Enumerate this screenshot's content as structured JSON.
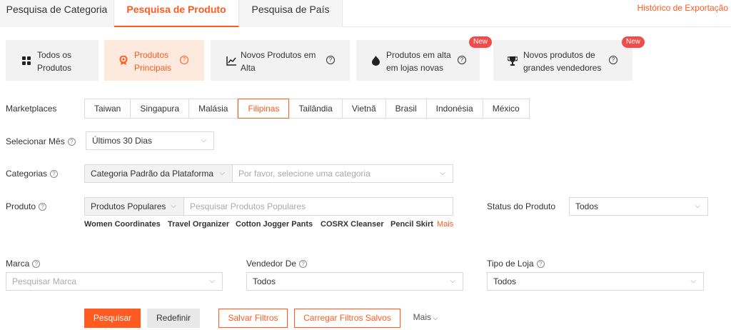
{
  "tabs": [
    {
      "label": "Pesquisa de Categoria",
      "active": false
    },
    {
      "label": "Pesquisa de Produto",
      "active": true
    },
    {
      "label": "Pesquisa de País",
      "active": false
    }
  ],
  "export_link": "Histórico de Exportação",
  "cards": [
    {
      "label": "Todos os Produtos",
      "icon": "grid-icon",
      "active": false,
      "help": false,
      "badge": ""
    },
    {
      "label": "Produtos Principais",
      "icon": "medal-icon",
      "active": true,
      "help": true,
      "badge": ""
    },
    {
      "label": "Novos Produtos em Alta",
      "icon": "trend-chart-icon",
      "active": false,
      "help": true,
      "badge": ""
    },
    {
      "label": "Produtos em alta em lojas novas",
      "icon": "flame-icon",
      "active": false,
      "help": true,
      "badge": "New"
    },
    {
      "label": "Novos produtos de grandes vendedores",
      "icon": "trophy-icon",
      "active": false,
      "help": true,
      "badge": "New"
    }
  ],
  "filters": {
    "marketplaces_label": "Marketplaces",
    "marketplaces": [
      "Taiwan",
      "Singapura",
      "Malásia",
      "Filipinas",
      "Tailândia",
      "Vietnã",
      "Brasil",
      "Indonésia",
      "México"
    ],
    "marketplace_selected": "Filipinas",
    "month_label": "Selecionar Mês",
    "month_value": "Últimos 30 Dias",
    "categories_label": "Categorias",
    "category_source": "Categoria Padrão da Plataforma",
    "category_placeholder": "Por favor, selecione uma categoria",
    "product_label": "Produto",
    "product_type": "Produtos Populares",
    "product_placeholder": "Pesquisar Produtos Populares",
    "product_status_label": "Status do Produto",
    "product_status_value": "Todos",
    "popular_keywords": [
      "Women Coordinates",
      "Travel Organizer",
      "Cotton Jogger Pants",
      "COSRX Cleanser",
      "Pencil Skirt"
    ],
    "more_keywords": "Mais",
    "brand_label": "Marca",
    "brand_placeholder": "Pesquisar Marca",
    "seller_label": "Vendedor De",
    "seller_value": "Todos",
    "store_type_label": "Tipo de Loja",
    "store_type_value": "Todos"
  },
  "actions": {
    "search": "Pesquisar",
    "reset": "Redefinir",
    "save_filters": "Salvar Filtros",
    "load_filters": "Carregar Filtros Salvos",
    "more": "Mais"
  },
  "colors": {
    "accent": "#ff5a1f",
    "badge": "#f34a4a",
    "card_bg": "#f2f2f2",
    "card_active_bg": "#fde9de"
  }
}
